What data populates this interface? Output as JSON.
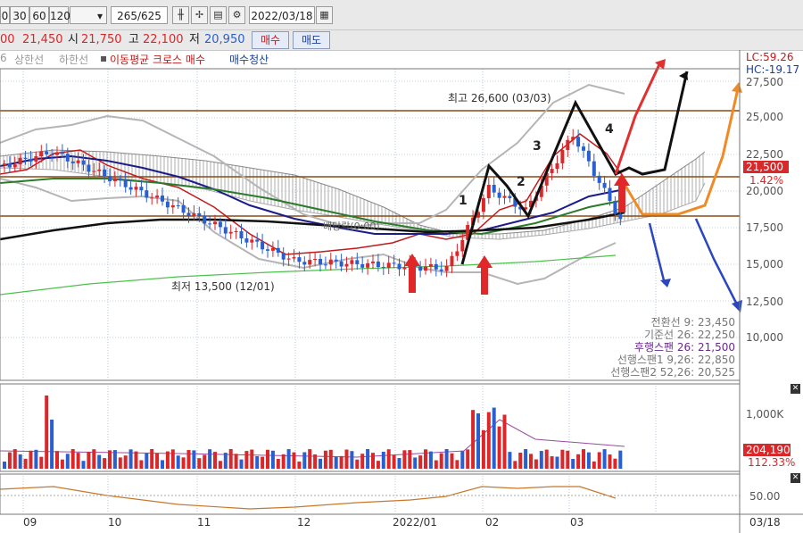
{
  "toolbar": {
    "periods": [
      "0",
      "30",
      "60",
      "120"
    ],
    "count": "265/625",
    "date": "2022/03/18",
    "icons": [
      "candle-icon",
      "crosshair-icon",
      "save-icon",
      "gear-icon",
      "calendar-icon"
    ]
  },
  "quote": {
    "close_frag": "00",
    "price": "21,450",
    "open_label": "시",
    "open": "21,750",
    "high_label": "고",
    "high": "22,100",
    "low_label": "저",
    "low": "20,950",
    "buy_label": "매수",
    "sell_label": "매도"
  },
  "legend": {
    "item0": "6",
    "item1": "상한선",
    "item2": "하한선",
    "item3": "이동평균 크로스 매수",
    "item4": "매수청산"
  },
  "price_axis": {
    "top_lc": "LC:59.26",
    "top_hc": "HC:-19.17",
    "ticks": [
      "27,500",
      "25,000",
      "22,500",
      "20,000",
      "17,500",
      "15,000",
      "12,500",
      "10,000"
    ],
    "current_price": "21,500",
    "current_pct": "1.42%"
  },
  "volume_axis": {
    "tick": "1,000K",
    "current": "204,190",
    "pct": "112.33%"
  },
  "osc_axis": {
    "tick": "50.00"
  },
  "x_labels": [
    "09",
    "10",
    "11",
    "12",
    "2022/01",
    "02",
    "03",
    "03/18"
  ],
  "annotations": {
    "high": "최고 26,600 (03/03)",
    "low": "최저 13,500 (12/01)",
    "wave": [
      "1",
      "2",
      "3",
      "4"
    ],
    "text_overlay": "배당락(0:00)"
  },
  "info_box": {
    "line1": "전환선 9: 23,450",
    "line2": "기준선 26: 22,250",
    "line3": "후행스팬 26: 21,500",
    "line4": "선행스팬1 9,26: 22,850",
    "line5": "선행스팬2 52,26: 20,525"
  },
  "colors": {
    "up": "#d9272a",
    "down": "#2a5fcf",
    "ma5": "#c11b1b",
    "ma20": "#1b1b8a",
    "ma60": "#2c7a2c",
    "ma120": "#111111",
    "cloud": "#9a9a9a",
    "hline": "#8a4b16"
  }
}
